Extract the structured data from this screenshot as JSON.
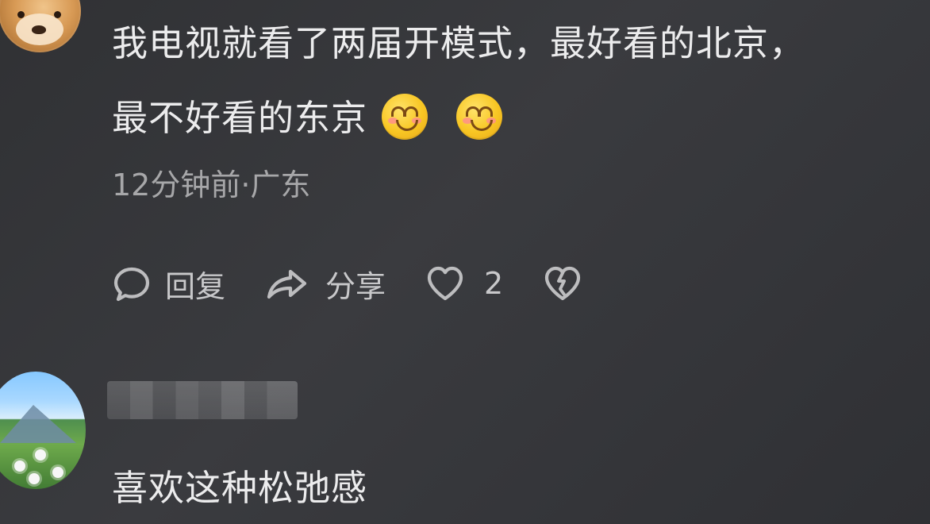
{
  "comment": {
    "line_1": "我电视就看了两届开模式，最好看的北京，",
    "line_2": "最不好看的东京",
    "meta": "12分钟前·广东",
    "actions": {
      "reply_label": "回复",
      "share_label": "分享",
      "like_count": "2"
    }
  },
  "second_comment": {
    "text": "喜欢这种松弛感"
  }
}
